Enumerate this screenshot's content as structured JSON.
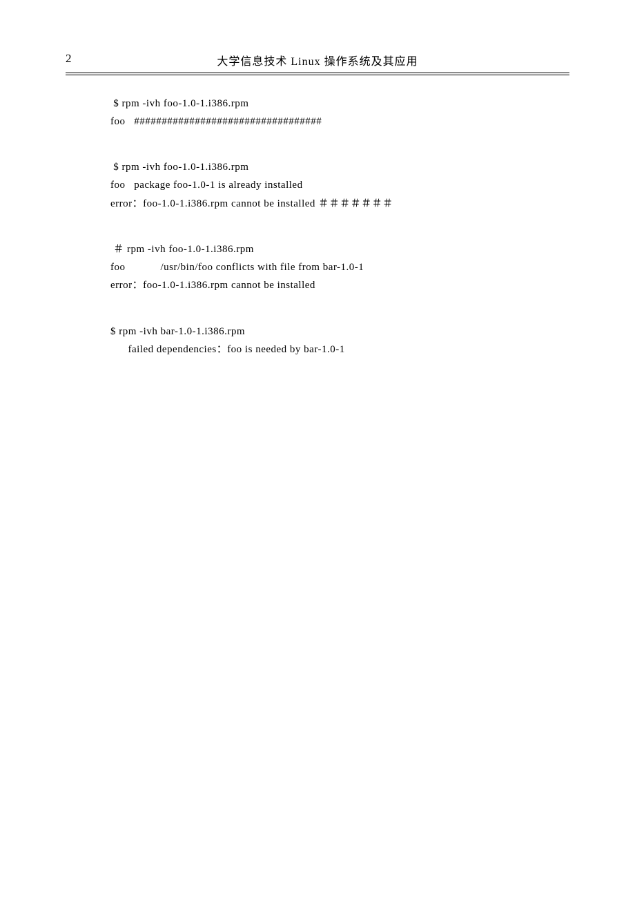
{
  "header": {
    "page_number": "2",
    "title": "大学信息技术 Linux 操作系统及其应用"
  },
  "blocks": [
    {
      "lines": [
        " $ rpm -ivh foo-1.0-1.i386.rpm",
        "foo   ##################################"
      ]
    },
    {
      "lines": [
        " $ rpm -ivh foo-1.0-1.i386.rpm",
        "foo   package foo-1.0-1 is already installed",
        "error：foo-1.0-1.i386.rpm cannot be installed ＃＃＃＃＃＃＃"
      ]
    },
    {
      "lines": [
        " ＃ rpm -ivh foo-1.0-1.i386.rpm",
        "foo            /usr/bin/foo conflicts with file from bar-1.0-1",
        "error：foo-1.0-1.i386.rpm cannot be installed"
      ]
    },
    {
      "lines": [
        "$ rpm -ivh bar-1.0-1.i386.rpm",
        "      failed dependencies：foo is needed by bar-1.0-1"
      ]
    }
  ]
}
